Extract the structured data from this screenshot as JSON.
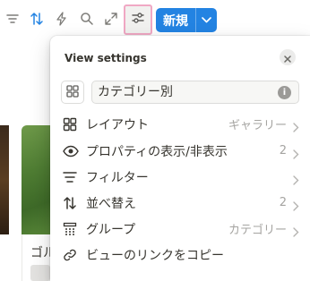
{
  "toolbar": {
    "icons": [
      "filter-icon",
      "sort-icon",
      "automation-icon",
      "search-icon",
      "expand-icon",
      "settings-sliders-icon"
    ],
    "new_label": "新規"
  },
  "background": {
    "card_caption": "ゴル"
  },
  "panel": {
    "title": "View settings",
    "view_name": "カテゴリー別",
    "info": "i",
    "items": [
      {
        "label": "レイアウト",
        "value": "ギャラリー",
        "icon": "layout-icon"
      },
      {
        "label": "プロパティの表示/非表示",
        "value": "2",
        "icon": "eye-icon"
      },
      {
        "label": "フィルター",
        "value": "",
        "icon": "filter-icon"
      },
      {
        "label": "並べ替え",
        "value": "2",
        "icon": "sort-icon"
      },
      {
        "label": "グループ",
        "value": "カテゴリー",
        "icon": "group-icon"
      },
      {
        "label": "ビューのリンクをコピー",
        "value": "",
        "icon": "link-icon"
      }
    ]
  }
}
